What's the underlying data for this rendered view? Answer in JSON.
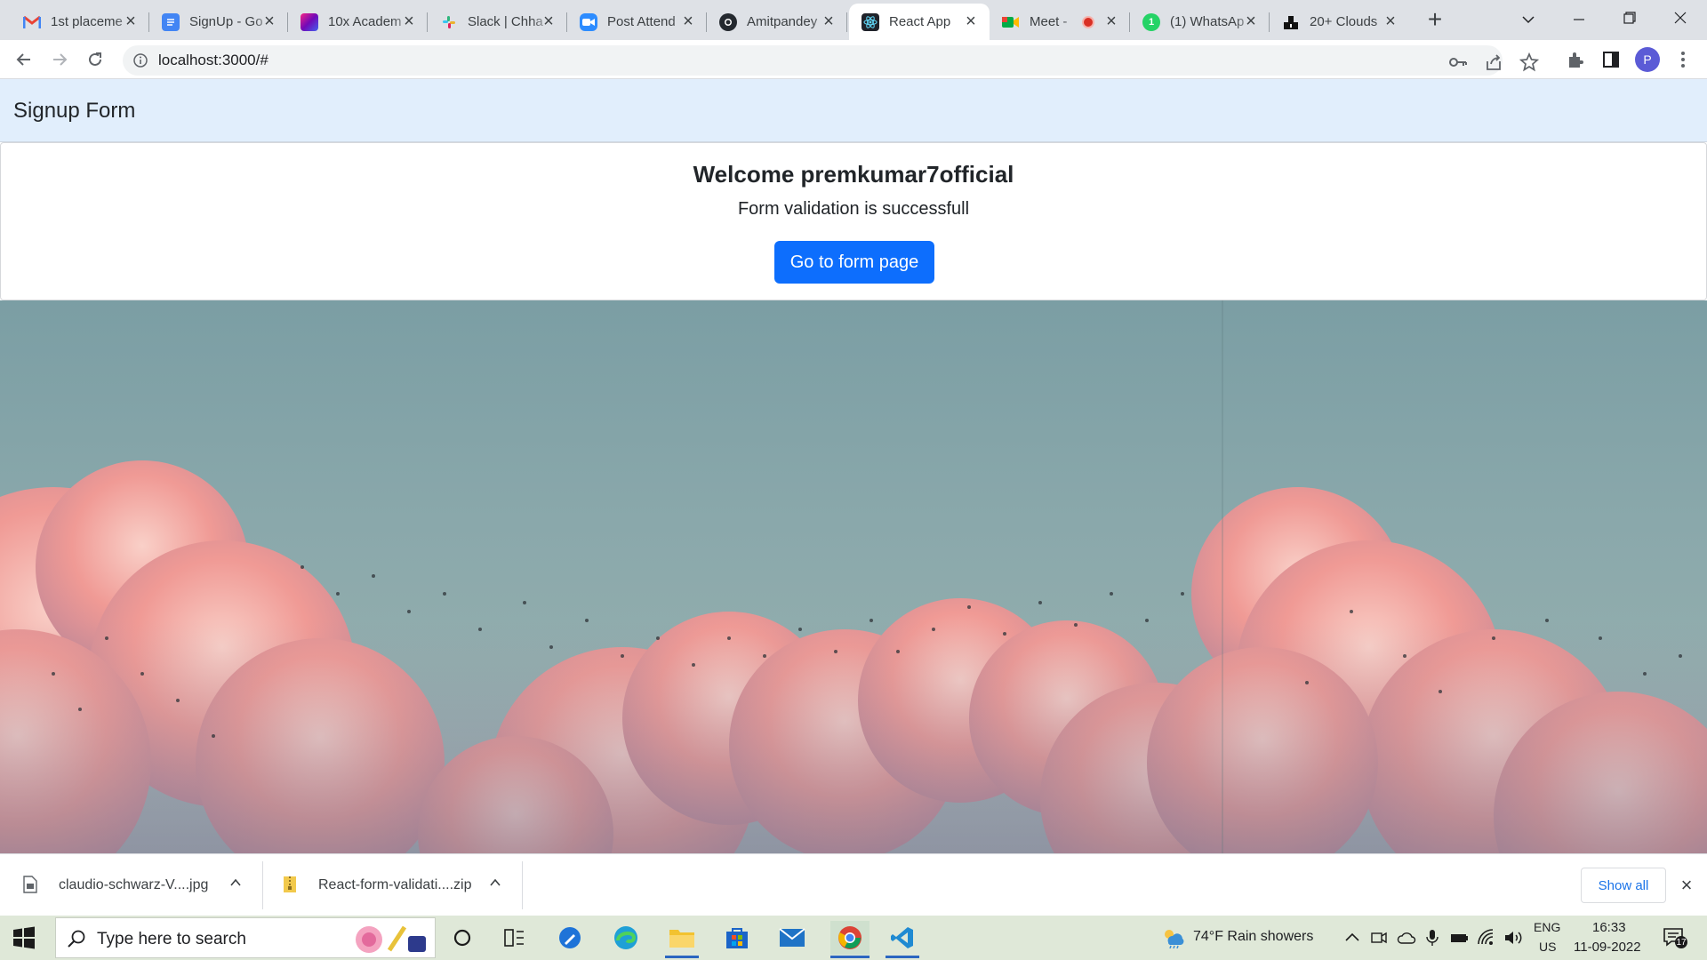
{
  "browser": {
    "tabs": [
      {
        "title": "1st placeme",
        "icon": "gmail-icon",
        "color": "#ea4335"
      },
      {
        "title": "SignUp - Go",
        "icon": "docs-icon",
        "color": "#4285f4"
      },
      {
        "title": "10x Academ",
        "icon": "academy-icon",
        "color": "#7b2cbf"
      },
      {
        "title": "Slack | Chha",
        "icon": "slack-icon",
        "color": "#e01e5a"
      },
      {
        "title": "Post Attend",
        "icon": "zoom-icon",
        "color": "#2d8cff"
      },
      {
        "title": "Amitpandey",
        "icon": "github-icon",
        "color": "#24292f"
      },
      {
        "title": "React App",
        "icon": "react-icon",
        "color": "#20232a",
        "active": true
      },
      {
        "title": "Meet -",
        "icon": "meet-icon",
        "color": "#00ac47"
      },
      {
        "title": "(1) WhatsAp",
        "icon": "whatsapp-icon",
        "color": "#25d366"
      },
      {
        "title": "20+ Clouds",
        "icon": "clouds-icon",
        "color": "#111111"
      }
    ],
    "url": "localhost:3000/#",
    "profile_initial": "P"
  },
  "page": {
    "brand": "Signup Form",
    "welcome": "Welcome premkumar7official",
    "message": "Form validation is successfull",
    "button_label": "Go to form page"
  },
  "downloads": {
    "items": [
      {
        "name": "claudio-schwarz-V....jpg",
        "icon": "image-file-icon"
      },
      {
        "name": "React-form-validati....zip",
        "icon": "zip-file-icon"
      }
    ],
    "show_all": "Show all"
  },
  "taskbar": {
    "search_placeholder": "Type here to search",
    "weather": "74°F  Rain showers",
    "language": "ENG",
    "region": "US",
    "time": "16:33",
    "date": "11-09-2022",
    "notifications": "17"
  },
  "colors": {
    "navbar_bg": "#e1eefc",
    "primary": "#0d6efd"
  }
}
